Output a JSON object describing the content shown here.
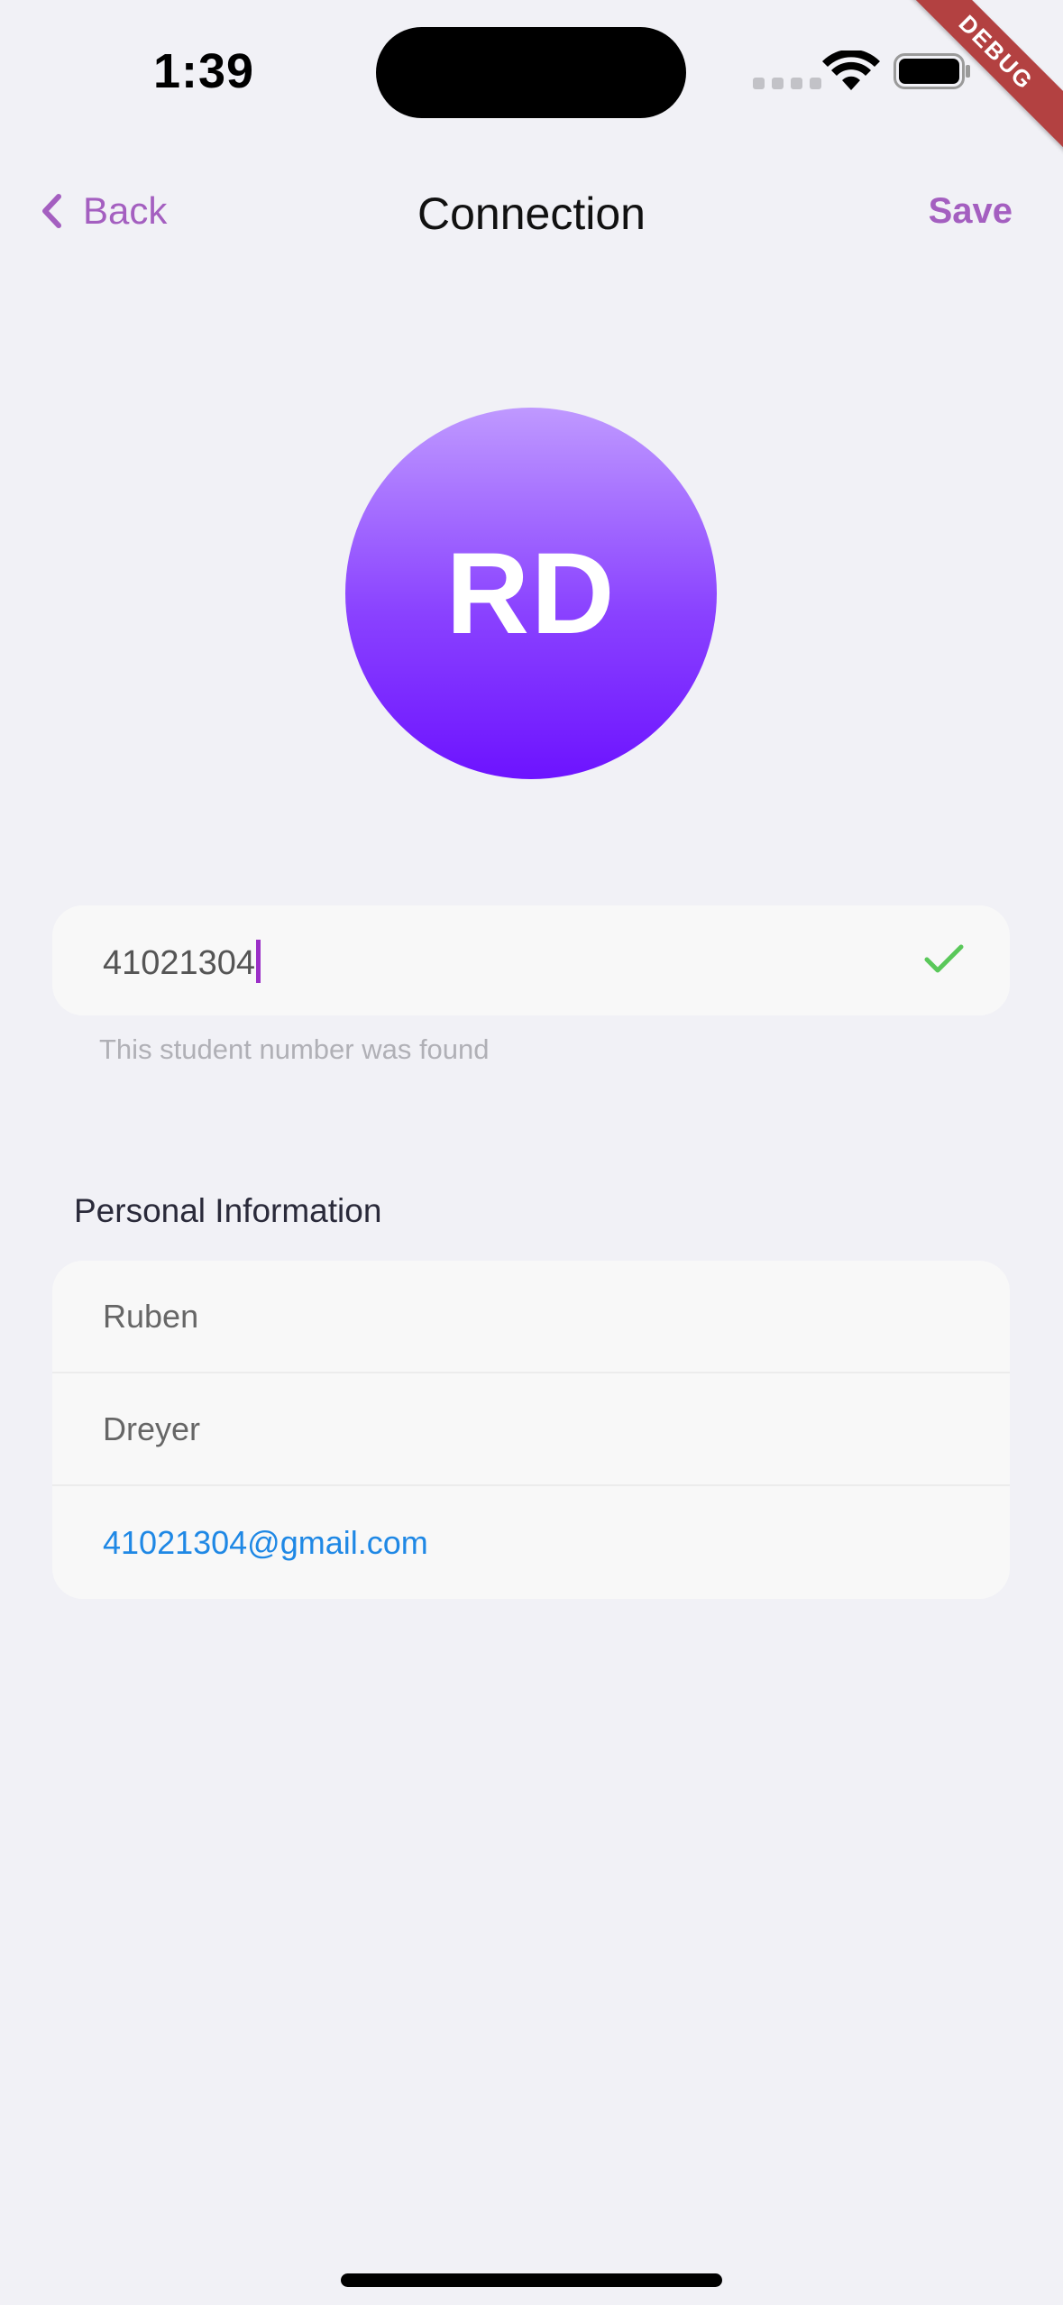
{
  "status_bar": {
    "time": "1:39"
  },
  "debug_banner": {
    "label": "DEBUG"
  },
  "nav": {
    "back_label": "Back",
    "title": "Connection",
    "save_label": "Save"
  },
  "avatar": {
    "initials": "RD"
  },
  "student_number": {
    "value": "41021304",
    "hint": "This student number was found"
  },
  "personal_info": {
    "heading": "Personal Information",
    "first_name": "Ruben",
    "last_name": "Dreyer",
    "email": "41021304@gmail.com"
  },
  "colors": {
    "accent": "#a45fc0",
    "caret": "#9b2fc7",
    "success": "#5ac85a",
    "link": "#1f88e5",
    "avatar_top": "#bf99ff",
    "avatar_bottom": "#6d13ff",
    "background": "#f1f1f6"
  },
  "icons": {
    "back": "chevron-left-icon",
    "valid": "checkmark-icon",
    "wifi": "wifi-icon",
    "battery": "battery-icon"
  }
}
